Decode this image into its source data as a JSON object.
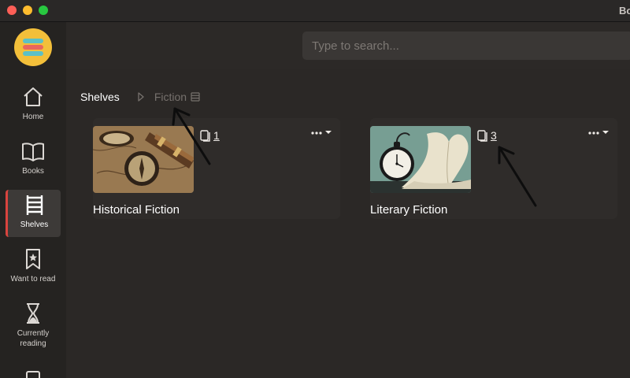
{
  "window": {
    "title": "Bo"
  },
  "sidebar": {
    "logo_icon": "books-stack-logo",
    "items": [
      {
        "label": "Home",
        "icon": "home-icon",
        "active": false
      },
      {
        "label": "Books",
        "icon": "open-book-icon",
        "active": false
      },
      {
        "label": "Shelves",
        "icon": "shelves-icon",
        "active": true
      },
      {
        "label": "Want to read",
        "icon": "bookmark-star-icon",
        "active": false
      },
      {
        "label": "Currently reading",
        "icon": "hourglass-icon",
        "active": false
      }
    ]
  },
  "search": {
    "placeholder": "Type to search..."
  },
  "breadcrumb": {
    "root": "Shelves",
    "current": "Fiction"
  },
  "shelves": [
    {
      "name": "Historical Fiction",
      "count": "1",
      "thumbnail": "antique map, compass and spyglass"
    },
    {
      "name": "Literary Fiction",
      "count": "3",
      "thumbnail": "pocket watch and book with heart-shaped pages"
    }
  ],
  "colors": {
    "active_accent": "#d9443e",
    "logo": "#f3bf3a",
    "background": "#2b2826"
  }
}
